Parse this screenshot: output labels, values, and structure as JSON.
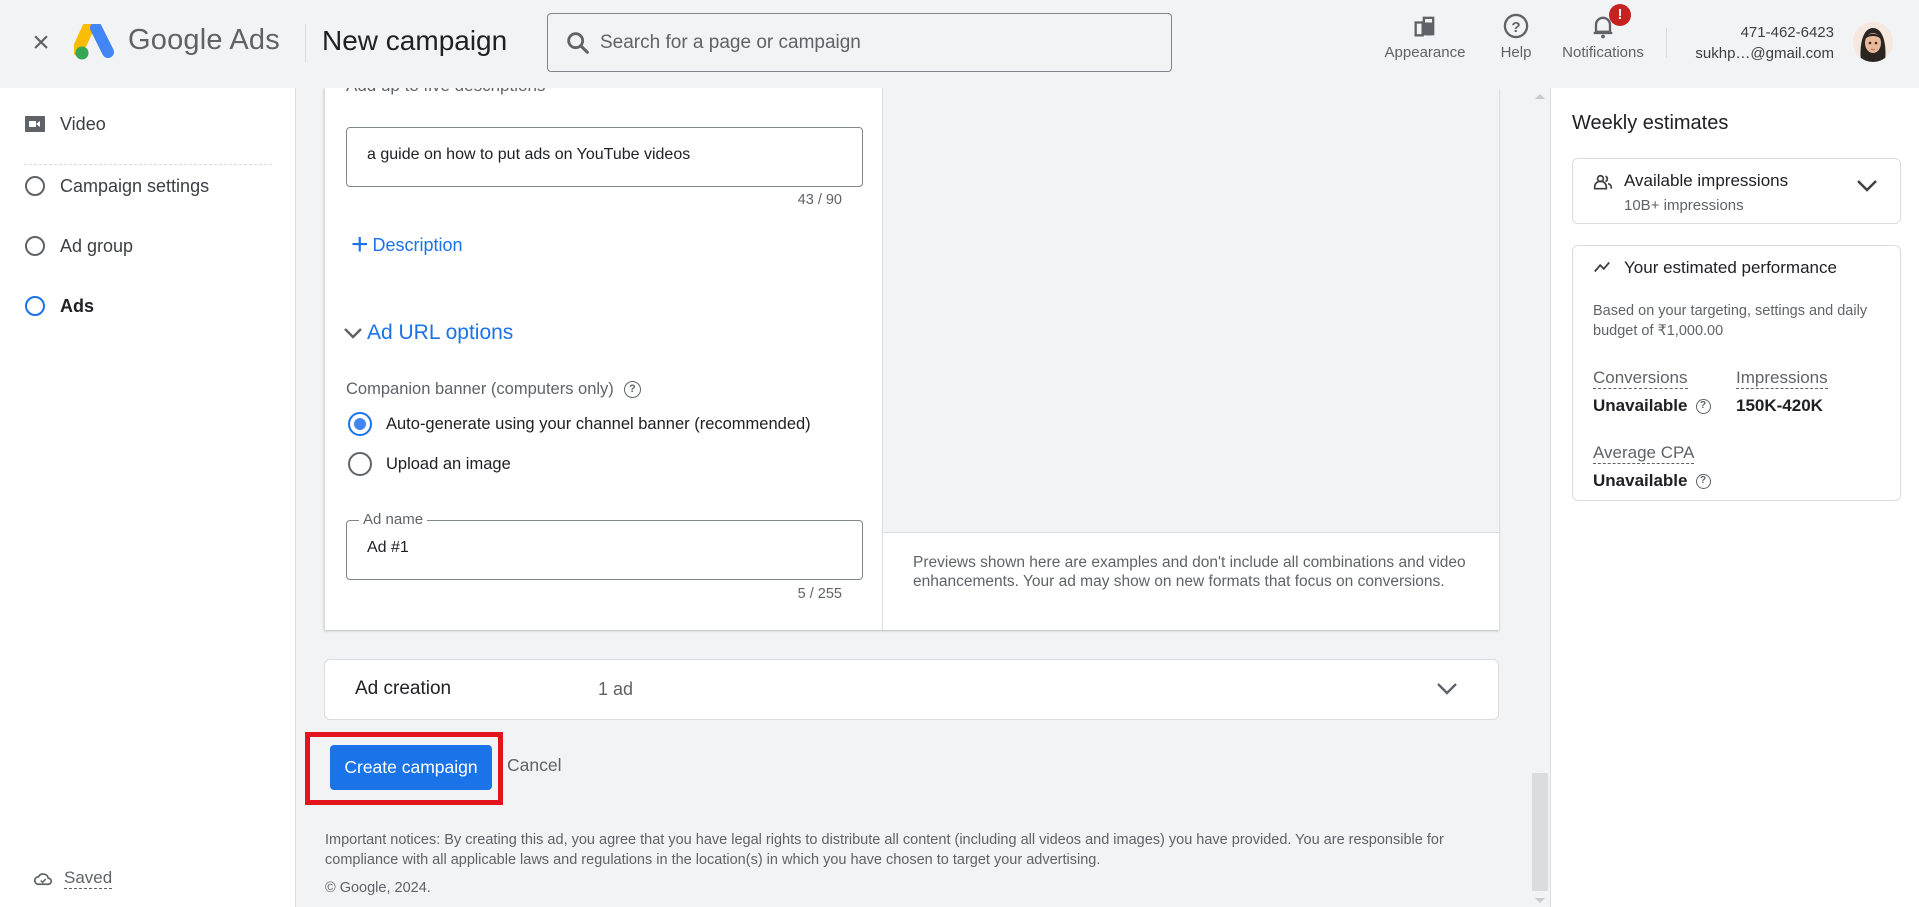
{
  "header": {
    "close_icon": "close-icon",
    "brand": "Google Ads",
    "page_title": "New campaign",
    "search": {
      "placeholder": "Search for a page or campaign",
      "value": ""
    },
    "actions": [
      {
        "id": "appearance",
        "label": "Appearance",
        "icon": "appearance-icon"
      },
      {
        "id": "help",
        "label": "Help",
        "icon": "help-icon"
      },
      {
        "id": "notifications",
        "label": "Notifications",
        "icon": "bell-icon",
        "badge": "!"
      }
    ],
    "account": {
      "id": "471-462-6423",
      "email": "sukhp…@gmail.com"
    },
    "colors": {
      "notification_badge": "#c5221f"
    }
  },
  "sidebar": {
    "items": [
      {
        "label": "Video",
        "icon": "video-icon",
        "state": "campaign-type"
      },
      {
        "label": "Campaign settings",
        "icon": "step-circle-icon",
        "state": "incomplete"
      },
      {
        "label": "Ad group",
        "icon": "step-circle-icon",
        "state": "incomplete"
      },
      {
        "label": "Ads",
        "icon": "step-circle-icon",
        "state": "current"
      }
    ],
    "saved_label": "Saved"
  },
  "form": {
    "descriptions_heading": "Add up to five descriptions",
    "description_value": "a guide on how to put ads on YouTube videos",
    "description_counter": "43 / 90",
    "add_description_label": "Description",
    "url_options_label": "Ad URL options",
    "companion_banner_label": "Companion banner (computers only)",
    "companion_options": [
      {
        "label": "Auto-generate using your channel banner (recommended)",
        "selected": true
      },
      {
        "label": "Upload an image",
        "selected": false
      }
    ],
    "ad_name_label": "Ad name",
    "ad_name_value": "Ad #1",
    "ad_name_counter": "5 / 255"
  },
  "preview": {
    "disclaimer": "Previews shown here are examples and don't include all combinations and video enhancements. Your ad may show on new formats that focus on conversions."
  },
  "ad_creation": {
    "title": "Ad creation",
    "summary": "1 ad"
  },
  "actions": {
    "create_label": "Create campaign",
    "cancel_label": "Cancel",
    "primary_color": "#1a73e8",
    "highlight_color": "#e4141f"
  },
  "footer": {
    "notice": "Important notices: By creating this ad, you agree that you have legal rights to distribute all content (including all videos and images) you have provided. You are responsible for compliance with all applicable laws and regulations in the location(s) in which you have chosen to target your advertising.",
    "copyright": "© Google, 2024."
  },
  "estimates": {
    "title": "Weekly estimates",
    "available_impressions": {
      "title": "Available impressions",
      "value": "10B+ impressions"
    },
    "performance": {
      "title": "Your estimated performance",
      "description": "Based on your targeting, settings and daily budget of ₹1,000.00",
      "metrics": [
        {
          "label": "Conversions",
          "value": "Unavailable",
          "help": true
        },
        {
          "label": "Impressions",
          "value": "150K-420K",
          "help": false
        },
        {
          "label": "Average CPA",
          "value": "Unavailable",
          "help": true
        }
      ]
    }
  }
}
